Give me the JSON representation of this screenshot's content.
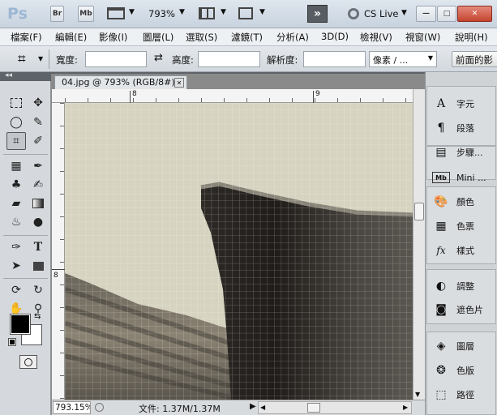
{
  "titlebar": {
    "logo": "Ps",
    "br": "Br",
    "mb": "Mb",
    "zoom": "793%",
    "cslive": "CS Live",
    "minimize": "—",
    "maximize": "□",
    "close": "✕"
  },
  "menu": [
    "檔案(F)",
    "編輯(E)",
    "影像(I)",
    "圖層(L)",
    "選取(S)",
    "濾鏡(T)",
    "分析(A)",
    "3D(D)",
    "檢視(V)",
    "視窗(W)",
    "說明(H)"
  ],
  "options": {
    "width_label": "寬度:",
    "swap": "⇄",
    "height_label": "高度:",
    "resolution_label": "解析度:",
    "unit": "像素 / ...",
    "front_image": "前面的影"
  },
  "document": {
    "tab_title": "04.jpg @ 793% (RGB/8#)",
    "tab_close": "✕",
    "ruler_top_labels": [
      "8",
      "9"
    ],
    "ruler_left_label": "8"
  },
  "status": {
    "zoom": "793.15%",
    "file_info": "文件: 1.37M/1.37M"
  },
  "panels": [
    "字元",
    "段落",
    "步驟...",
    "Mini ...",
    "顏色",
    "色票",
    "樣式",
    "調整",
    "遮色片",
    "圖層",
    "色版",
    "路徑"
  ],
  "colors": {
    "foreground": "#000000",
    "background": "#ffffff",
    "canvas_light": "#d6d3c0"
  }
}
